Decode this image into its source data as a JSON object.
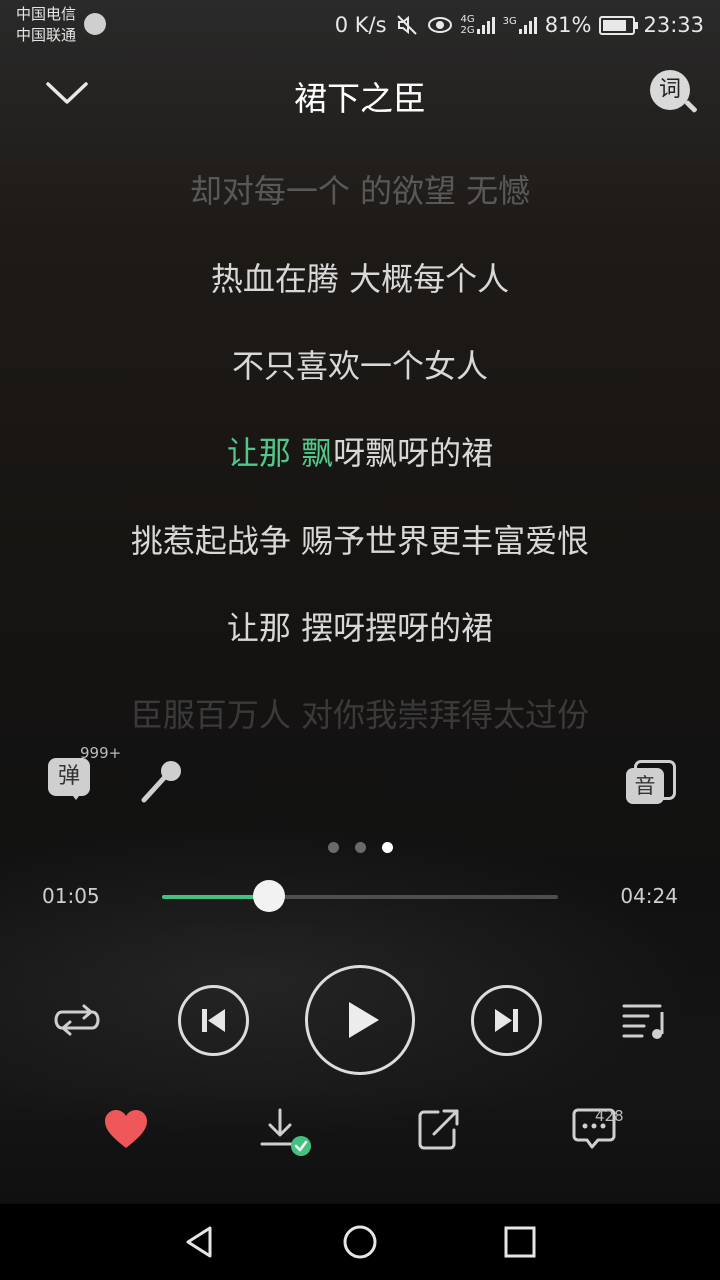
{
  "status_bar": {
    "carrier_1": "中国电信",
    "carrier_2": "中国联通",
    "network_speed": "0 K/s",
    "net_type_1_top": "4G",
    "net_type_1_bottom": "2G",
    "net_type_2": "3G",
    "battery": "81%",
    "battery_level": 0.81,
    "time": "23:33"
  },
  "header": {
    "title": "裙下之臣",
    "lyric_search_label": "词",
    "collapse_icon": "chevron-down-icon"
  },
  "lyrics": {
    "lines": [
      {
        "text": "却对每一个 的欲望 无憾",
        "state": "faded"
      },
      {
        "text": "热血在腾 大概每个人",
        "state": "normal"
      },
      {
        "text": "不只喜欢一个女人",
        "state": "normal"
      },
      {
        "text": "飘呀飘呀的裙",
        "sung": "让那 飘",
        "rest": "呀飘呀的裙",
        "state": "current"
      },
      {
        "text": "挑惹起战争 赐予世界更丰富爱恨",
        "state": "normal"
      },
      {
        "text": "让那 摆呀摆呀的裙",
        "state": "normal"
      },
      {
        "text": "臣服百万人 对你我崇拜得太过份",
        "state": "faded2"
      }
    ]
  },
  "tools": {
    "danmu_label": "弹",
    "danmu_count": "999+",
    "sound_effect_label": "音"
  },
  "pager": {
    "count": 3,
    "active": 3
  },
  "progress": {
    "current_time": "01:05",
    "total_time": "04:24",
    "fraction": 0.27
  },
  "comments": {
    "count": "428"
  },
  "colors": {
    "accent": "#45c17f",
    "like": "#f0575b",
    "text": "#d8d8d8"
  }
}
